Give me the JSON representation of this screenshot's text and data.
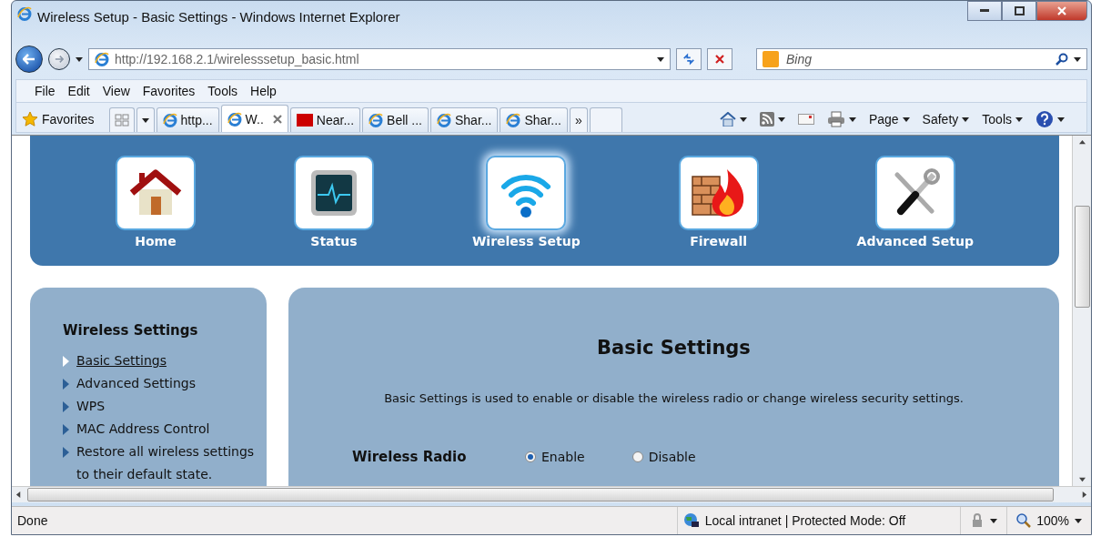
{
  "window": {
    "title": "Wireless Setup - Basic Settings - Windows Internet Explorer"
  },
  "address_bar": {
    "value": "http://192.168.2.1/wirelesssetup_basic.html"
  },
  "search": {
    "placeholder": "Bing"
  },
  "menu": [
    "File",
    "Edit",
    "View",
    "Favorites",
    "Tools",
    "Help"
  ],
  "favorites": {
    "label": "Favorites"
  },
  "tabs": [
    {
      "label": "http...",
      "kind": "ie",
      "selected": false
    },
    {
      "label": "W..",
      "kind": "ie",
      "selected": true
    },
    {
      "label": "Near...",
      "kind": "cnn",
      "selected": false
    },
    {
      "label": "Bell ...",
      "kind": "ie",
      "selected": false
    },
    {
      "label": "Shar...",
      "kind": "ie",
      "selected": false
    },
    {
      "label": "Shar...",
      "kind": "ie",
      "selected": false
    }
  ],
  "tab_overflow": "»",
  "command_bar": [
    "Page",
    "Safety",
    "Tools"
  ],
  "nav": [
    {
      "label": "Home",
      "kind": "home",
      "selected": false
    },
    {
      "label": "Status",
      "kind": "status",
      "selected": false
    },
    {
      "label": "Wireless Setup",
      "kind": "wireless",
      "selected": true
    },
    {
      "label": "Firewall",
      "kind": "firewall",
      "selected": false
    },
    {
      "label": "Advanced Setup",
      "kind": "tools",
      "selected": false
    }
  ],
  "sidebar": {
    "title": "Wireless Settings",
    "items": [
      {
        "label": "Basic Settings",
        "selected": true
      },
      {
        "label": "Advanced Settings",
        "selected": false
      },
      {
        "label": "WPS",
        "selected": false
      },
      {
        "label": "MAC Address Control",
        "selected": false
      },
      {
        "label": "Restore all wireless settings to their default state.",
        "selected": false
      }
    ]
  },
  "main": {
    "heading": "Basic Settings",
    "description": "Basic Settings is used to enable or disable the wireless radio or change wireless security settings.",
    "fields": [
      {
        "label": "Wireless Radio",
        "options": [
          {
            "label": "Enable",
            "selected": true
          },
          {
            "label": "Disable",
            "selected": false
          }
        ]
      }
    ]
  },
  "status_bar": {
    "text": "Done",
    "zone": "Local intranet | Protected Mode: Off",
    "zoom": "100%"
  }
}
